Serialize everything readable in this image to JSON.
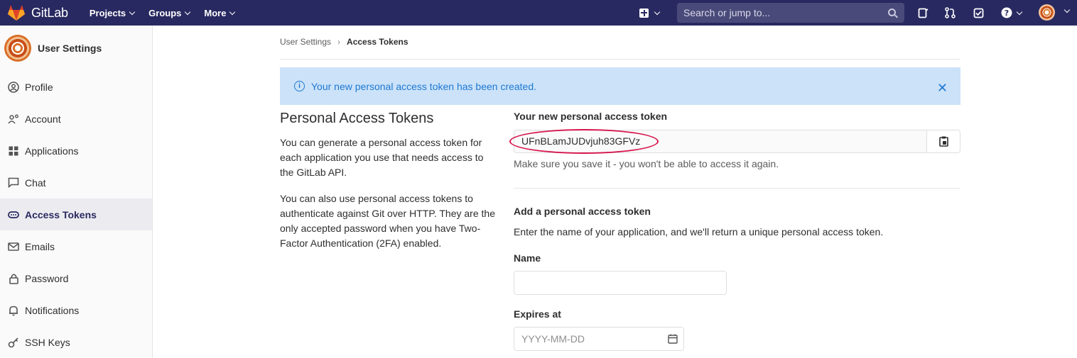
{
  "topbar": {
    "brand": "GitLab",
    "nav": [
      "Projects",
      "Groups",
      "More"
    ],
    "search_placeholder": "Search or jump to...",
    "icons": [
      "plus-icon",
      "search-icon",
      "todo-icon",
      "merge-request-icon",
      "issues-icon",
      "help-icon",
      "user-avatar"
    ]
  },
  "sidebar": {
    "title": "User Settings",
    "items": [
      {
        "label": "Profile",
        "icon": "profile-icon"
      },
      {
        "label": "Account",
        "icon": "account-icon"
      },
      {
        "label": "Applications",
        "icon": "applications-icon"
      },
      {
        "label": "Chat",
        "icon": "chat-icon"
      },
      {
        "label": "Access Tokens",
        "icon": "token-icon",
        "active": true
      },
      {
        "label": "Emails",
        "icon": "email-icon"
      },
      {
        "label": "Password",
        "icon": "lock-icon"
      },
      {
        "label": "Notifications",
        "icon": "bell-icon"
      },
      {
        "label": "SSH Keys",
        "icon": "key-icon"
      }
    ]
  },
  "breadcrumb": {
    "parent": "User Settings",
    "current": "Access Tokens"
  },
  "alert": {
    "message": "Your new personal access token has been created.",
    "color": "#1f78d1"
  },
  "main": {
    "title": "Personal Access Tokens",
    "para1": "You can generate a personal access token for each application you use that needs access to the GitLab API.",
    "para2": "You can also use personal access tokens to authenticate against Git over HTTP. They are the only accepted password when you have Two-Factor Authentication (2FA) enabled.",
    "new_token_label": "Your new personal access token",
    "new_token_value": "UFnBLamJUDvjuh83GFVz",
    "save_hint": "Make sure you save it - you won't be able to access it again.",
    "add_title": "Add a personal access token",
    "add_desc": "Enter the name of your application, and we'll return a unique personal access token.",
    "name_label": "Name",
    "name_value": "",
    "expires_label": "Expires at",
    "expires_placeholder": "YYYY-MM-DD"
  },
  "colors": {
    "nav_bg": "#292961",
    "highlight_ellipse": "#d6134a"
  }
}
